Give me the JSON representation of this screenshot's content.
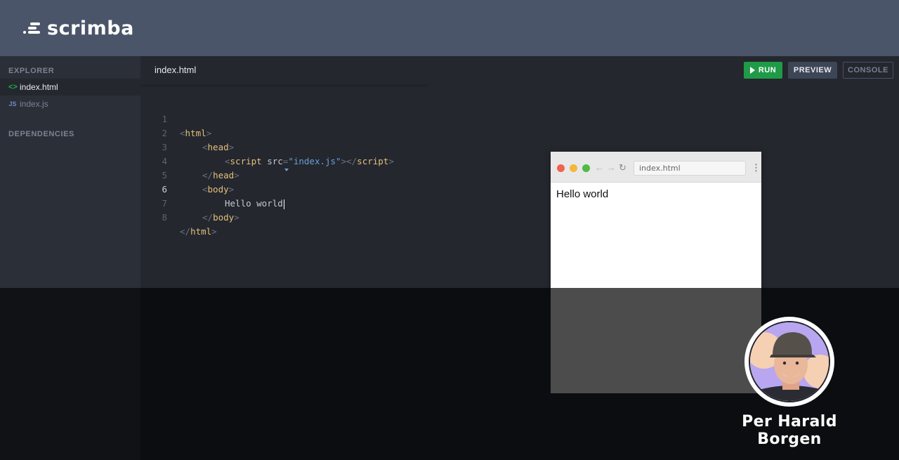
{
  "app": {
    "logo_text": "scrimba"
  },
  "sidebar": {
    "explorer_title": "EXPLORER",
    "files": [
      {
        "name": "index.html",
        "icon": "html-icon",
        "icon_glyph": "<>",
        "active": true
      },
      {
        "name": "index.js",
        "icon": "js-icon",
        "icon_glyph": "JS",
        "active": false
      }
    ],
    "dependencies_title": "DEPENDENCIES"
  },
  "editor": {
    "tab_title": "index.html",
    "buttons": {
      "run": "RUN",
      "preview": "PREVIEW",
      "console": "CONSOLE"
    },
    "line_numbers": [
      "1",
      "2",
      "3",
      "4",
      "5",
      "6",
      "7",
      "8"
    ],
    "active_line": 6,
    "code": {
      "l1": {
        "lt": "<",
        "tag": "html",
        "gt": ">"
      },
      "l2": {
        "lt": "<",
        "tag": "head",
        "gt": ">"
      },
      "l3": {
        "lt": "<",
        "tag": "script",
        "attr": "src",
        "eq": "=",
        "val": "\"index.js\"",
        "mid": "></",
        "tag2": "script",
        "gt": ">"
      },
      "l4": {
        "lt": "</",
        "tag": "head",
        "gt": ">"
      },
      "l5": {
        "lt": "<",
        "tag": "body",
        "gt": ">"
      },
      "l6": {
        "text": "Hello world"
      },
      "l7": {
        "lt": "</",
        "tag": "body",
        "gt": ">"
      },
      "l8": {
        "lt": "</",
        "tag": "html",
        "gt": ">"
      }
    }
  },
  "preview": {
    "url": "index.html",
    "content_text": "Hello world",
    "nav_icons": {
      "back": "←",
      "forward": "→",
      "reload": "↻",
      "more": "⋮"
    }
  },
  "presenter": {
    "name": "Per Harald Borgen"
  },
  "colors": {
    "header_bg": "#4a5569",
    "run_green": "#1f9b47",
    "tag_yellow": "#e6c07b",
    "string_blue": "#6c9fd8"
  }
}
